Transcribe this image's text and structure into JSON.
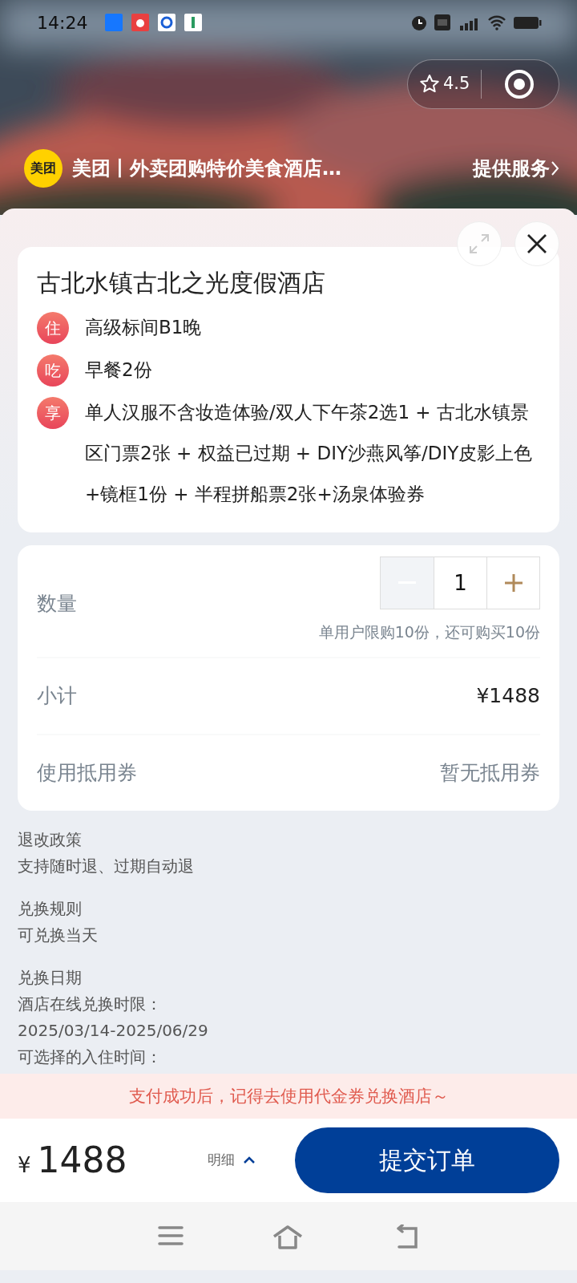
{
  "status_bar": {
    "time": "14:24"
  },
  "mini_program": {
    "logo": "美团",
    "rating": "4.5",
    "name": "美团丨外卖团购特价美食酒店…",
    "service_link": "提供服务"
  },
  "hotel": {
    "name": "古北水镇古北之光度假酒店",
    "items": [
      {
        "tag": "住",
        "text": "高级标间B1晚"
      },
      {
        "tag": "吃",
        "text": "早餐2份"
      },
      {
        "tag": "享",
        "text": "单人汉服不含妆造体验/双人下午茶2选1 + 古北水镇景区门票2张 + 权益已过期 + DIY沙燕风筝/DIY皮影上色+镜框1份 + 半程拼船票2张+汤泉体验券"
      }
    ]
  },
  "order": {
    "quantity_label": "数量",
    "quantity": "1",
    "decrement_disabled": true,
    "limit_note": "单用户限购10份，还可购买10份",
    "subtotal_label": "小计",
    "subtotal": "¥1488",
    "coupon_label": "使用抵用券",
    "coupon_value": "暂无抵用券"
  },
  "policies": [
    {
      "title": "退改政策",
      "lines": [
        "支持随时退、过期自动退"
      ]
    },
    {
      "title": "兑换规则",
      "lines": [
        "可兑换当天"
      ]
    },
    {
      "title": "兑换日期",
      "lines": [
        "酒店在线兑换时限：",
        "2025/03/14-2025/06/29",
        "可选择的入住时间："
      ]
    }
  ],
  "notice": "支付成功后，记得去使用代金券兑换酒店～",
  "footer": {
    "currency": "¥",
    "total": "1488",
    "details_label": "明细",
    "submit": "提交订单"
  }
}
